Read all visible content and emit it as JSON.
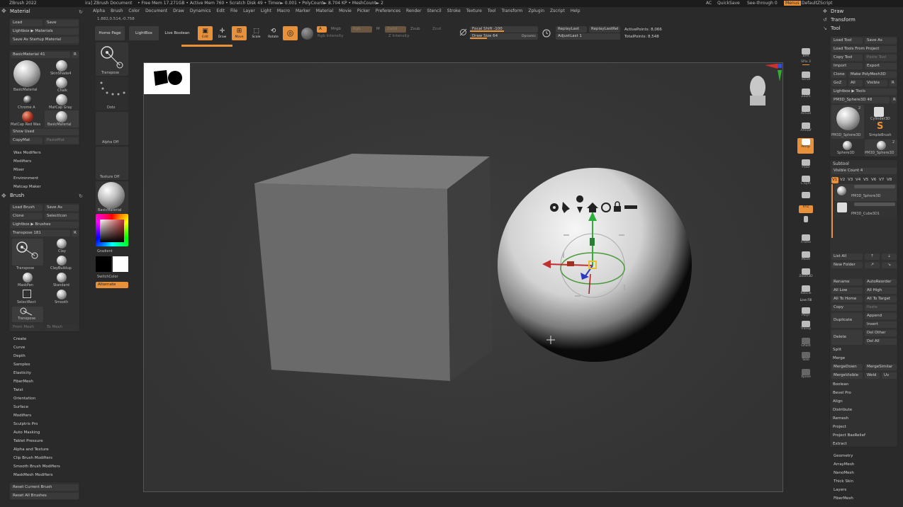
{
  "titlebar": {
    "app": "ZBrush 2022",
    "doc": "ira]  ZBrush Document",
    "stats": "• Free Mem 17.271GB  • Active Mem 760  • Scratch Disk 49  • Timer► 0.001  • PolyCount► 8.704 KP  • MeshCount► 2",
    "ac": "AC",
    "quicksave": "QuickSave",
    "seethrough": "See-through  0",
    "menus": "Menus",
    "script": "DefaultZScript"
  },
  "menubar": [
    "Alpha",
    "Brush",
    "Color",
    "Document",
    "Draw",
    "Dynamics",
    "Edit",
    "File",
    "Layer",
    "Light",
    "Macro",
    "Marker",
    "Material",
    "Movie",
    "Picker",
    "Preferences",
    "Render",
    "Stencil",
    "Stroke",
    "Texture",
    "Tool",
    "Transform",
    "Zplugin",
    "Zscript",
    "Help"
  ],
  "coords": "1.882,0.514,-0.758",
  "shelf": {
    "home": "Home Page",
    "lightbox": "LightBox",
    "liveboolean": "Live Boolean",
    "edit": "Edit",
    "draw": "Draw",
    "move": "Move",
    "scale": "Scale",
    "rotate": "Rotate",
    "a": "A",
    "mrgb": "Mrgb",
    "rgb": "Rgb",
    "m": "M",
    "zadd": "Zadd",
    "zsub": "Zsub",
    "zcut": "Zcut",
    "rgb_intensity": "Rgb Intensity",
    "z_intensity": "Z Intensity",
    "focal_shift": "Focal Shift -100",
    "draw_size": "Draw Size 64",
    "dynamic": "Dynamic",
    "replaylast": "ReplayLast",
    "replaylastrel": "ReplayLastRel",
    "adjustlast": "AdjustLast 1",
    "activepoints": "ActivePoints: 8,066",
    "totalpoints": "TotalPoints: 8,548",
    "focal_shift_level": 0.5,
    "draw_size_level": 0.25
  },
  "material": {
    "title": "Material",
    "load": "Load",
    "save": "Save",
    "lightbox": "Lightbox ▶ Materials",
    "startup": "Save As Startup Material",
    "current": "BasicMaterial  41",
    "r": "R",
    "thumbs": [
      "BasicMaterial",
      "SkinShade4",
      "Chalk",
      "Chrome A",
      "MatCap Gray",
      "MatCap Red Wax",
      "BasicMaterial"
    ],
    "showused": "Show Used",
    "copymat": "CopyMat",
    "pastemat": "PasteMat",
    "subs": [
      "Wax Modifiers",
      "Modifiers",
      "Mixer",
      "Environment",
      "Matcap Maker"
    ]
  },
  "brush": {
    "title": "Brush",
    "loadbrush": "Load Brush",
    "saveas": "Save As",
    "clone": "Clone",
    "selecticon": "SelectIcon",
    "lightbox": "Lightbox ▶ Brushes",
    "current": "Transpose  181",
    "r": "R",
    "thumbs": [
      "Transpose",
      "Clay",
      "ClayBuildup",
      "MaskPen",
      "Standard",
      "SelectRect",
      "Smooth",
      "Transpose"
    ],
    "frommesh": "From Mesh",
    "tomesh": "To Mesh",
    "subs": [
      "Create",
      "Curve",
      "Depth",
      "Samples",
      "Elasticity",
      "FiberMesh",
      "Twist",
      "Orientation",
      "Surface",
      "Modifiers",
      "Sculptris Pro",
      "Auto Masking",
      "Tablet Pressure",
      "Alpha and Texture",
      "Clip Brush Modifiers",
      "Smooth Brush Modifiers",
      "MaskMesh Modifiers"
    ],
    "reset_current": "Reset Current Brush",
    "reset_all": "Reset All Brushes"
  },
  "leftshelf": {
    "transpose": "Transpose",
    "dots": "Dots",
    "alphaoff": "Alpha Off",
    "textureoff": "Texture Off",
    "basicmaterial": "BasicMaterial",
    "gradient": "Gradient",
    "switchcolor": "SwitchColor",
    "alternate": "Alternate"
  },
  "righttools": [
    "BPR",
    "SPix 3",
    "Scroll",
    "Zoom",
    "Actual",
    "AAHalf",
    "Persp",
    "Floor",
    "L.Sym",
    "XYZ",
    "Frame",
    "Move",
    "Zoom3D",
    "RotaTe",
    "Line Fill",
    "PolyF",
    "Transp",
    "Ghost",
    "Solo",
    "Xpose"
  ],
  "tool": {
    "draw": "Draw",
    "transform": "Transform",
    "tool": "Tool",
    "loadtool": "Load Tool",
    "saveas": "Save As",
    "loadproject": "Load Tools From Project",
    "copytool": "Copy Tool",
    "pastetool": "Paste Tool",
    "import": "Import",
    "export": "Export",
    "clone": "Clone",
    "makepoly": "Make PolyMesh3D",
    "goz": "GoZ",
    "all": "All",
    "visible": "Visible",
    "r": "R",
    "lightbox": "Lightbox ▶ Tools",
    "current": "PM3D_Sphere3D  48",
    "thumbs": [
      "PM3D_Sphere3D",
      "Cylinder3D",
      "SimpleBrush",
      "Sphere3D",
      "PM3D_Sphere3D"
    ],
    "count2a": "2",
    "count2b": "2",
    "subtool": "Subtool",
    "visiblecount": "Visible Count 4",
    "vtabs": [
      "V1",
      "V2",
      "V3",
      "V4",
      "V5",
      "V6",
      "V7",
      "V8"
    ],
    "subtools": [
      "PM3D_Sphere3D",
      "PM3D_Cube3D1"
    ],
    "listall": "List All",
    "newfolder": "New Folder",
    "rename": "Rename",
    "autoreorder": "AutoReorder",
    "alllow": "All Low",
    "allhigh": "All High",
    "alltohome": "All To Home",
    "alltotarget": "All To Target",
    "copy": "Copy",
    "paste": "Paste",
    "duplicate": "Duplicate",
    "append": "Append",
    "insert": "Insert",
    "delete": "Delete",
    "delother": "Del Other",
    "delall": "Del All",
    "split": "Split",
    "merge": "Merge",
    "mergedown": "MergeDown",
    "mergesimilar": "MergeSimilar",
    "mergevisible": "MergeVisible",
    "weld": "Weld",
    "uv": "Uv",
    "subs": [
      "Boolean",
      "Bevel Pro",
      "Align",
      "Distribute",
      "Remesh",
      "Project",
      "Project BasRelief",
      "Extract"
    ],
    "subs2": [
      "Geometry",
      "ArrayMesh",
      "NanoMesh",
      "Thick Skin",
      "Layers",
      "FiberMesh"
    ]
  },
  "colors": {
    "accent": "#e8903a",
    "panel": "#313131",
    "bg": "#2a2a2a"
  }
}
